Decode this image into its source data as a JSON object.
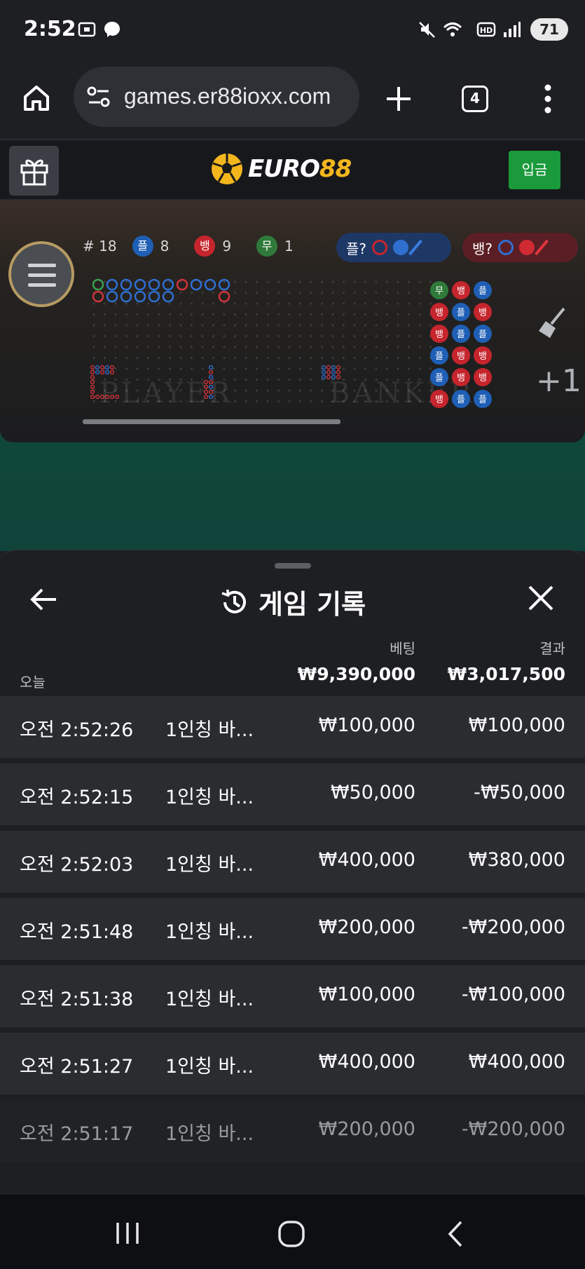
{
  "status_bar": {
    "time": "2:52",
    "battery": "71",
    "icons": [
      "screenshot-icon",
      "messenger-icon",
      "mute-icon",
      "wifi-icon",
      "hd-icon",
      "signal-icon",
      "battery-icon"
    ]
  },
  "browser": {
    "url": "games.er88ioxx.com",
    "tab_count": "4"
  },
  "site": {
    "logo_text_a": "EURO",
    "logo_text_b": "88",
    "deposit_label": "입금"
  },
  "scoreboard": {
    "round": "# 18",
    "player_badge": "플",
    "player_count": "8",
    "banker_badge": "뱅",
    "banker_count": "9",
    "tie_badge": "무",
    "tie_count": "1",
    "player_predict": "플?",
    "banker_predict": "뱅?",
    "plus_label": "+1",
    "road_player": "PLAYER",
    "road_banker": "BANKER",
    "bead_columns": [
      [
        "무",
        "뱅",
        "뱅",
        "플",
        "플",
        "뱅"
      ],
      [
        "뱅",
        "플",
        "플",
        "뱅",
        "뱅",
        "플"
      ],
      [
        "플",
        "뱅",
        "플",
        "뱅",
        "뱅",
        "플"
      ]
    ],
    "colors": {
      "player": "#1f5fb5",
      "banker": "#c6252d",
      "tie": "#2f7a3a"
    }
  },
  "sheet": {
    "title": "게임 기록",
    "col_bet": "베팅",
    "col_result": "결과",
    "today_label": "오늘",
    "total_bet": "₩9,390,000",
    "total_result": "₩3,017,500",
    "rows": [
      {
        "time": "오전 2:52:26",
        "game": "1인칭 바...",
        "bet": "₩100,000",
        "result": "₩100,000"
      },
      {
        "time": "오전 2:52:15",
        "game": "1인칭 바...",
        "bet": "₩50,000",
        "result": "-₩50,000"
      },
      {
        "time": "오전 2:52:03",
        "game": "1인칭 바...",
        "bet": "₩400,000",
        "result": "₩380,000"
      },
      {
        "time": "오전 2:51:48",
        "game": "1인칭 바...",
        "bet": "₩200,000",
        "result": "-₩200,000"
      },
      {
        "time": "오전 2:51:38",
        "game": "1인칭 바...",
        "bet": "₩100,000",
        "result": "-₩100,000"
      },
      {
        "time": "오전 2:51:27",
        "game": "1인칭 바...",
        "bet": "₩400,000",
        "result": "₩400,000"
      },
      {
        "time": "오전 2:51:17",
        "game": "1인칭 바...",
        "bet": "₩200,000",
        "result": "-₩200,000"
      }
    ]
  }
}
